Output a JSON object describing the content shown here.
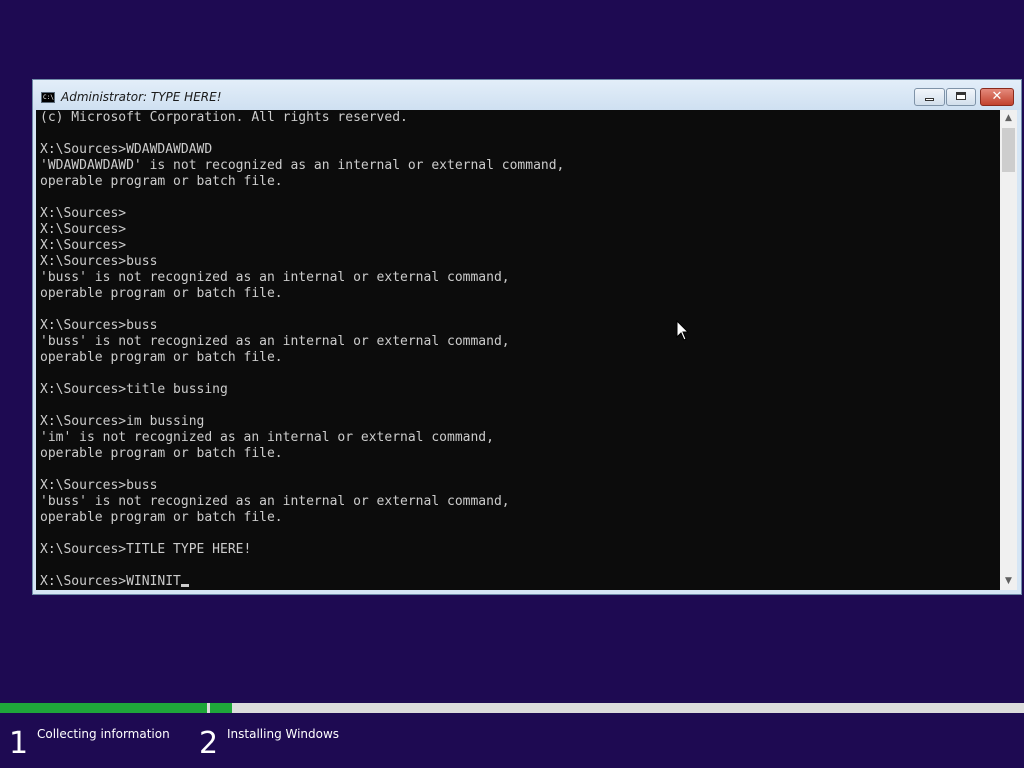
{
  "window": {
    "title": "Administrator:  TYPE HERE!",
    "icon": "console-icon",
    "icon_glyph": "C:\\",
    "buttons": {
      "minimize": "minimize-icon",
      "maximize": "maximize-icon",
      "close": "close-icon",
      "close_glyph": "✕"
    }
  },
  "console": {
    "background": "#0c0c0c",
    "text_color": "#cccccc",
    "lines": [
      "(c) Microsoft Corporation. All rights reserved.",
      "",
      "X:\\Sources>WDAWDAWDAWD",
      "'WDAWDAWDAWD' is not recognized as an internal or external command,",
      "operable program or batch file.",
      "",
      "X:\\Sources>",
      "X:\\Sources>",
      "X:\\Sources>",
      "X:\\Sources>buss",
      "'buss' is not recognized as an internal or external command,",
      "operable program or batch file.",
      "",
      "X:\\Sources>buss",
      "'buss' is not recognized as an internal or external command,",
      "operable program or batch file.",
      "",
      "X:\\Sources>title bussing",
      "",
      "X:\\Sources>im bussing",
      "'im' is not recognized as an internal or external command,",
      "operable program or batch file.",
      "",
      "X:\\Sources>buss",
      "'buss' is not recognized as an internal or external command,",
      "operable program or batch file.",
      "",
      "X:\\Sources>TITLE TYPE HERE!",
      ""
    ],
    "current_input": "X:\\Sources>WININIT"
  },
  "scrollbar": {
    "up_icon": "▲",
    "down_icon": "▼"
  },
  "setup": {
    "progress_color": "#1fa63a",
    "steps": [
      {
        "number": "1",
        "label": "Collecting information"
      },
      {
        "number": "2",
        "label": "Installing Windows"
      }
    ]
  },
  "colors": {
    "desktop_background": "#1e0a52",
    "accent_green": "#1fa63a"
  }
}
